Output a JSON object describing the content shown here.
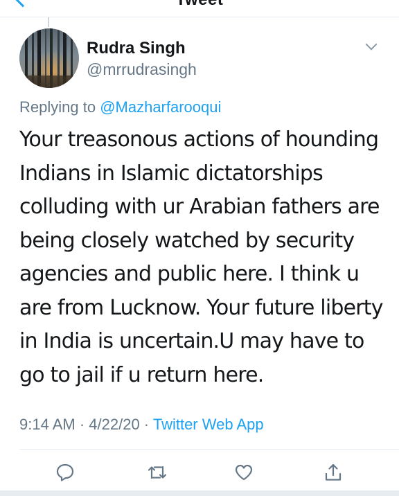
{
  "nav": {
    "title": "Tweet"
  },
  "tweet": {
    "author_name": "Rudra Singh",
    "author_handle": "@mrrudrasingh",
    "replying_prefix": "Replying to ",
    "replying_mention": "@Mazharfarooqui",
    "lines": [
      "Your treasonous actions of hounding",
      "Indians in Islamic dictatorships",
      "colluding with ur Arabian fathers are",
      "being closely watched by security",
      "agencies and public here. I think u",
      "are from Lucknow. Your future liberty",
      "in India is uncertain.U may have to",
      "go to jail if u return here."
    ],
    "time": "9:14 AM",
    "separator": " · ",
    "date": "4/22/20",
    "source": "Twitter Web App"
  },
  "actions": {
    "reply_icon": "reply-icon",
    "retweet_icon": "retweet-icon",
    "like_icon": "heart-icon",
    "share_icon": "share-icon"
  },
  "colors": {
    "accent": "#1da1f2",
    "secondary_text": "#657786",
    "primary_text": "#14171a",
    "divider": "#e6ecf0"
  }
}
